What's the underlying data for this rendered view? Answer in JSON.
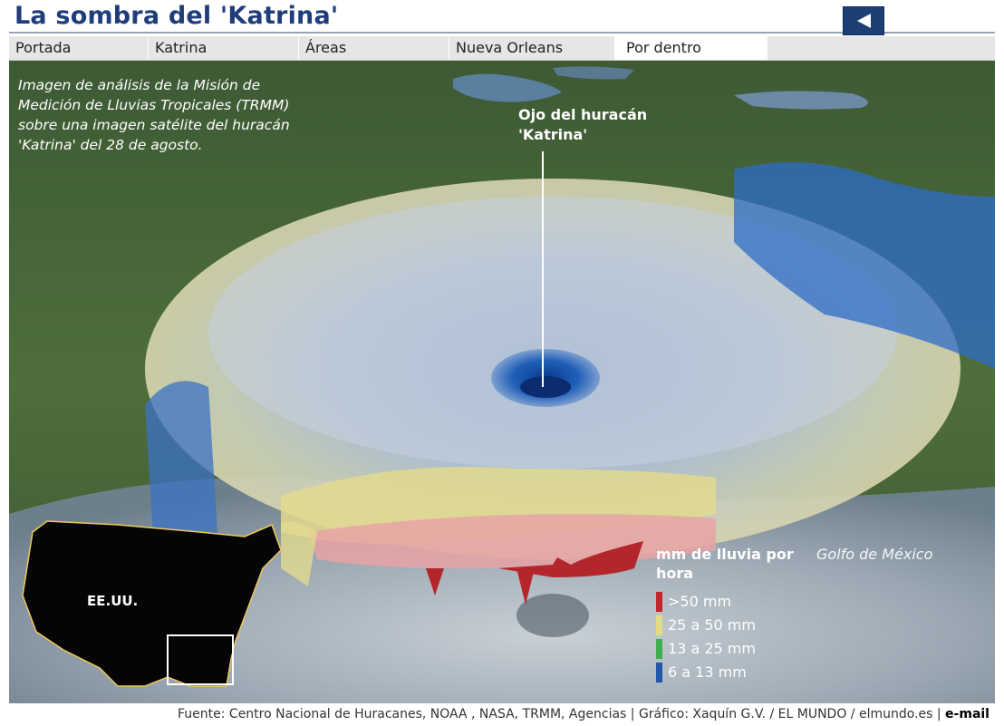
{
  "header": {
    "title": "La sombra del 'Katrina'",
    "back_icon": "back-arrow-icon"
  },
  "nav": {
    "tabs": [
      {
        "label": "Portada"
      },
      {
        "label": "Katrina"
      },
      {
        "label": "Áreas"
      },
      {
        "label": "Nueva Orleans"
      },
      {
        "label": "Por dentro",
        "active": true
      }
    ]
  },
  "graphic": {
    "caption": "Imagen de análisis de la Misión de Medición de Lluvias Tropicales (TRMM) sobre una imagen satélite del huracán 'Katrina' del 28 de agosto.",
    "eye_label": "Ojo del huracán\n'Katrina'",
    "gulf_label": "Golfo de México",
    "map_label": "EE.UU.",
    "legend": {
      "title": "mm de lluvia por hora",
      "items": [
        {
          "label": ">50 mm",
          "color": "#c0262b"
        },
        {
          "label": "25 a 50 mm",
          "color": "#e3dc86"
        },
        {
          "label": "13 a 25 mm",
          "color": "#3fae52"
        },
        {
          "label": "6 a 13 mm",
          "color": "#2456a8"
        }
      ]
    }
  },
  "footer": {
    "credits": "Fuente: Centro Nacional de Huracanes, NOAA , NASA, TRMM, Agencias | Gráfico: Xaquín G.V. / EL MUNDO / elmundo.es | ",
    "email": "e-mail"
  }
}
